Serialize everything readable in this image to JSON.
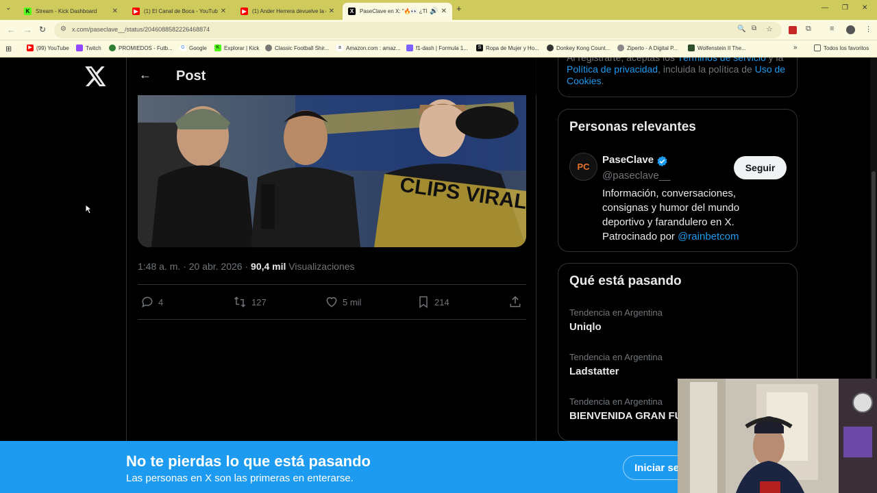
{
  "browser": {
    "tabs": [
      {
        "title": "Stream - Kick Dashboard",
        "icon": "kick-icon",
        "color": "#53fc18"
      },
      {
        "title": "(1) El Canal de Boca - YouTube",
        "icon": "youtube-icon",
        "color": "#ff0000"
      },
      {
        "title": "(1) Ander Herrera devuelve la c",
        "icon": "youtube-icon",
        "color": "#ff0000"
      },
      {
        "title": "PaseClave en X: \"🔥👀 ¿TE",
        "icon": "x-icon",
        "color": "#000000"
      }
    ],
    "url": "x.com/paseclave__/status/2046088582226468874",
    "bookmarks": [
      {
        "label": "(99) YouTube",
        "icon": "youtube-icon",
        "color": "#ff0000"
      },
      {
        "label": "Twitch",
        "icon": "twitch-icon",
        "color": "#9146ff"
      },
      {
        "label": "PROMIEDOS - Futb...",
        "icon": "promiedos-icon",
        "color": "#2e7d32"
      },
      {
        "label": "Google",
        "icon": "google-icon",
        "color": "#4285f4"
      },
      {
        "label": "Explorar | Kick",
        "icon": "kick-icon",
        "color": "#53fc18"
      },
      {
        "label": "Classic Football Shir...",
        "icon": "shirt-icon",
        "color": "#555555"
      },
      {
        "label": "Amazon.com : amaz...",
        "icon": "amazon-icon",
        "color": "#222222"
      },
      {
        "label": "f1-dash | Formula 1...",
        "icon": "f1-icon",
        "color": "#7b61ff"
      },
      {
        "label": "Ropa de Mujer y Ho...",
        "icon": "shop-icon",
        "color": "#111111"
      },
      {
        "label": "Donkey Kong Count...",
        "icon": "game-icon",
        "color": "#333333"
      },
      {
        "label": "Ziperto - A Digital P...",
        "icon": "globe-icon",
        "color": "#666666"
      },
      {
        "label": "Wolfenstein II The...",
        "icon": "game-icon",
        "color": "#2d4d2d"
      }
    ],
    "all_bookmarks": "Todos los favoritos"
  },
  "post": {
    "header_title": "Post",
    "time": "1:48 a. m.",
    "separator": "·",
    "date": "20 abr. 2026",
    "views_count": "90,4 mil",
    "views_label": "Visualizaciones",
    "replies": "4",
    "reposts": "127",
    "likes": "5 mil",
    "bookmarks": "214",
    "media_text": "CLIPS VIRALES"
  },
  "sidebar": {
    "terms": {
      "part1": "Al registrarte, aceptas los ",
      "link1": "Términos de servicio",
      "part2": " y la ",
      "link2": "Política de privacidad",
      "part3": ", incluida la política de ",
      "link3": "Uso de Cookies",
      "part4": "."
    },
    "people": {
      "title": "Personas relevantes",
      "name": "PaseClave",
      "handle": "@paseclave__",
      "avatar_text": "PC",
      "bio": "Información, conversaciones, consignas y humor del mundo deportivo y farandulero en X. Patrocinado por ",
      "bio_link": "@rainbetcom",
      "follow_label": "Seguir"
    },
    "trends": {
      "title": "Qué está pasando",
      "items": [
        {
          "context": "Tendencia en Argentina",
          "name": "Uniqlo"
        },
        {
          "context": "Tendencia en Argentina",
          "name": "Ladstatter"
        },
        {
          "context": "Tendencia en Argentina",
          "name": "BIENVENIDA GRAN FU"
        }
      ]
    }
  },
  "banner": {
    "title": "No te pierdas lo que está pasando",
    "subtitle": "Las personas en X son las primeras en enterarse.",
    "login_label": "Iniciar se"
  },
  "colors": {
    "x_blue": "#1d9bf0",
    "browser_frame": "#ceca5c",
    "text_secondary": "#71767b"
  }
}
